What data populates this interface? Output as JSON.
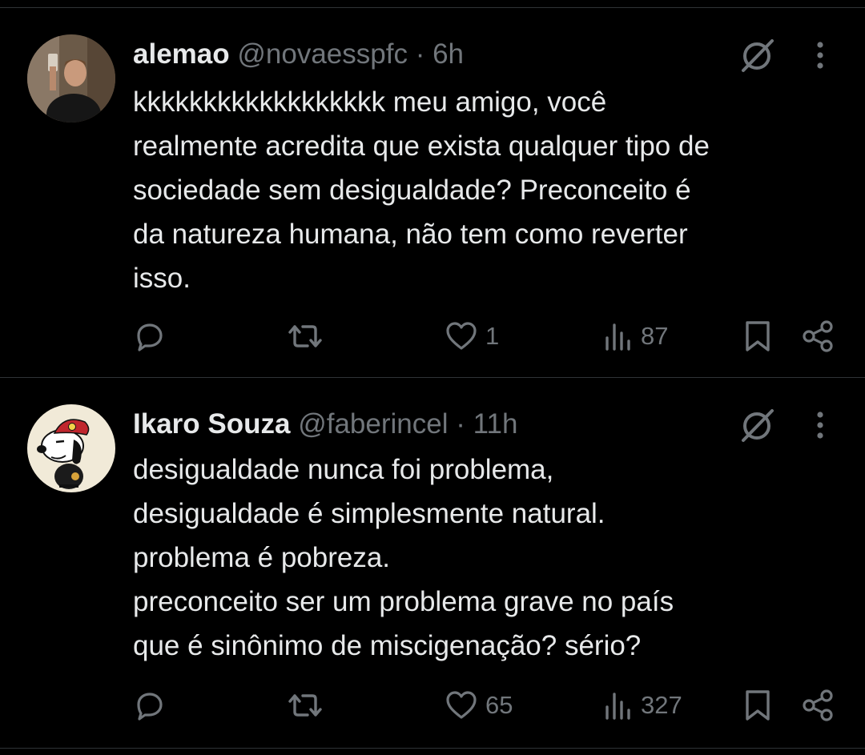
{
  "tweets": [
    {
      "name": "alemao",
      "handle": "@novaesspfc",
      "separator": "·",
      "time": "6h",
      "lines": [
        "kkkkkkkkkkkkkkkkkk meu amigo, você",
        "realmente acredita que exista qualquer tipo de",
        "sociedade sem desigualdade? Preconceito é",
        "da natureza humana, não tem como reverter",
        "isso."
      ],
      "likes": "1",
      "views": "87",
      "icons": {
        "reply": "reply-icon",
        "retweet": "retweet-icon",
        "like": "heart-icon",
        "views": "views-icon",
        "bookmark": "bookmark-icon",
        "share": "share-icon",
        "grok": "grok-icon",
        "more": "more-icon"
      }
    },
    {
      "name": "Ikaro Souza",
      "handle": "@faberincel",
      "separator": "·",
      "time": "11h",
      "lines": [
        "desigualdade nunca foi problema,",
        "desigualdade é simplesmente natural.",
        "problema é pobreza.",
        "preconceito ser um problema grave no país",
        "que é sinônimo de miscigenação? sério?"
      ],
      "likes": "65",
      "views": "327",
      "icons": {
        "reply": "reply-icon",
        "retweet": "retweet-icon",
        "like": "heart-icon",
        "views": "views-icon",
        "bookmark": "bookmark-icon",
        "share": "share-icon",
        "grok": "grok-icon",
        "more": "more-icon"
      }
    }
  ],
  "colors": {
    "background": "#000000",
    "text_primary": "#e7e9ea",
    "text_secondary": "#71767b",
    "divider": "#2f3336"
  }
}
